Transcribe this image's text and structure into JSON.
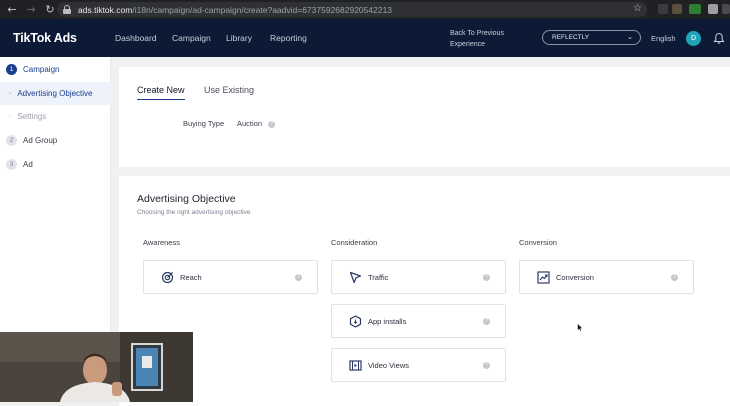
{
  "browser": {
    "url_host": "ads.tiktok.com",
    "url_path": "/i18n/campaign/ad-campaign/create?aadvid=6737592682920542213"
  },
  "header": {
    "logo": "TikTok Ads",
    "nav": [
      "Dashboard",
      "Campaign",
      "Library",
      "Reporting"
    ],
    "back_link_line1": "Back To Previous",
    "back_link_line2": "Experience",
    "account": "REFLECTLY",
    "language": "English",
    "avatar_letter": "D"
  },
  "sidebar": {
    "items": [
      {
        "step": "1",
        "label": "Campaign"
      },
      {
        "label": "Advertising Objective"
      },
      {
        "label": "Settings"
      },
      {
        "step": "2",
        "label": "Ad Group"
      },
      {
        "step": "3",
        "label": "Ad"
      }
    ]
  },
  "campaign": {
    "tabs": [
      "Create New",
      "Use Existing"
    ],
    "buying_type_label": "Buying Type",
    "buying_type_value": "Auction"
  },
  "objective": {
    "title": "Advertising Objective",
    "subtitle": "Choosing the right advertising objective",
    "columns": [
      {
        "title": "Awareness",
        "items": [
          "Reach"
        ]
      },
      {
        "title": "Consideration",
        "items": [
          "Traffic",
          "App installs",
          "Video Views"
        ]
      },
      {
        "title": "Conversion",
        "items": [
          "Conversion"
        ]
      }
    ]
  },
  "colors": {
    "header_bg": "#0c1a36",
    "accent": "#1a3d8f",
    "avatar": "#1fa5b8"
  }
}
